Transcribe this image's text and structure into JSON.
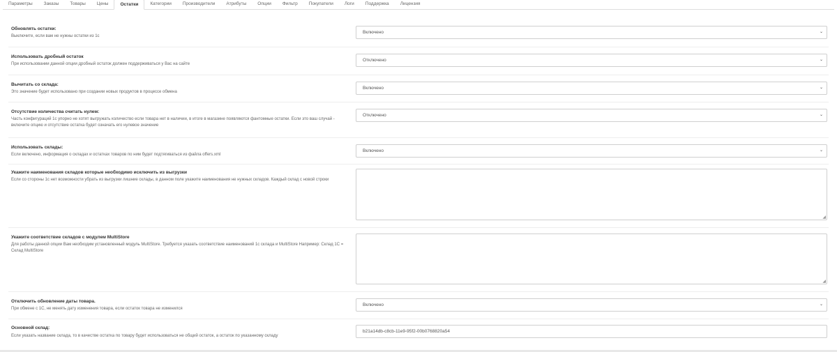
{
  "tabs": [
    "Параметры",
    "Заказы",
    "Товары",
    "Цены",
    "Остатки",
    "Категории",
    "Производители",
    "Атрибуты",
    "Опции",
    "Фильтр",
    "Покупатели",
    "Логи",
    "Поддержка",
    "Лицензия"
  ],
  "active_tab": "Остатки",
  "settings": [
    {
      "label": "Обновлять остатки:",
      "help": "Выключите, если вам не нужны остатки из 1с",
      "control": "select",
      "value": "Включено"
    },
    {
      "label": "Использовать дробный остаток",
      "help": "При использовании данной опции дробный остаток должен поддерживаться у Вас на сайте",
      "control": "select",
      "value": "Отключено"
    },
    {
      "label": "Вычитать со склада:",
      "help": "Это значение будет использовано при создании новых продуктов в процессе обмена",
      "control": "select",
      "value": "Включено"
    },
    {
      "label": "Отсутствие количества считать нулем:",
      "help": "Часть конфигураций 1с упорно не хотят выгружать количество если товара нет в наличии, в итоге в магазине появляются фантомные остатки. Если это ваш случай - включите опцию и отсутствие остатка будет означать его нулевое значение",
      "control": "select",
      "value": "Отключено"
    },
    {
      "label": "Использовать склады:",
      "help": "Если включено, информация о складах и остатках товаров по ним будет подтягиваться из файла offers.xml",
      "control": "select",
      "value": "Включено"
    },
    {
      "label": "Укажите наименования складов которые необходимо исключить из выгрузки",
      "help": "Если со стороны 1с нет возможности убрать из выгрузки лишние склады, в данном поле укажите наименования не нужных складов. Каждый склад с новой строки",
      "control": "textarea",
      "value": ""
    },
    {
      "label": "Укажите соответствие складов с модулем MultiStore",
      "help": "Для работы данной опции Вам необходим установленный модуль MultiStore. Требуется указать соответствие наименований 1с склада и MultiStore Например: Склад 1С = Склад MultiStore",
      "control": "textarea",
      "value": ""
    },
    {
      "label": "Отключить обновление даты товара.",
      "help": "При обмене с 1С, не менять дату изменения товара, если остаток товара не изменился",
      "control": "select",
      "value": "Включено"
    },
    {
      "label": "Основной склад:",
      "help": "Если указать название склада, то в качестве остатка по товару будет использоваться не общий остаток, а остаток по указанному складу",
      "control": "input",
      "value": "b21a14db-c8cb-11e9-95f2-00b0768820a54"
    }
  ],
  "icons": {
    "select_arrow": "chevron-down-icon",
    "resize": "resize-grip-icon"
  }
}
